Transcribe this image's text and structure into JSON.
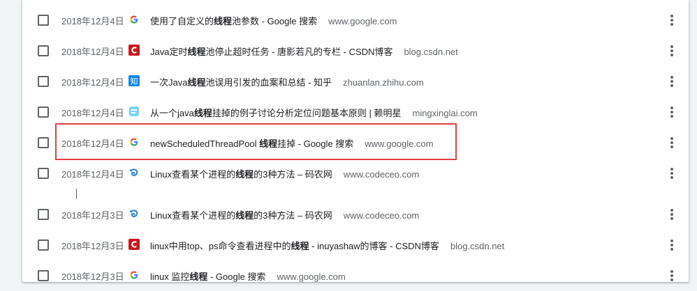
{
  "history": {
    "items": [
      {
        "date": "2018年12月4日",
        "favicon": "google-icon",
        "pre": "使用了自定义的",
        "bold": "线程",
        "post": "池参数 - Google 搜索",
        "domain": "www.google.com"
      },
      {
        "date": "2018年12月4日",
        "favicon": "csdn-icon",
        "pre": "Java定时",
        "bold": "线程",
        "post": "池停止超时任务 - 唐影若凡的专栏 - CSDN博客",
        "domain": "blog.csdn.net"
      },
      {
        "date": "2018年12月4日",
        "favicon": "zhihu-icon",
        "pre": "一次Java",
        "bold": "线程",
        "post": "池误用引发的血案和总结 - 知乎",
        "domain": "zhuanlan.zhihu.com"
      },
      {
        "date": "2018年12月4日",
        "favicon": "blog-icon",
        "pre": "从一个java",
        "bold": "线程",
        "post": "挂掉的例子讨论分析定位问题基本原则 | 赖明星",
        "domain": "mingxinglai.com"
      },
      {
        "date": "2018年12月4日",
        "favicon": "google-icon",
        "pre": "newScheduledThreadPool ",
        "bold": "线程",
        "post": "挂掉 - Google 搜索",
        "domain": "www.google.com"
      },
      {
        "date": "2018年12月4日",
        "favicon": "codeceo-icon",
        "pre": "Linux查看某个进程的",
        "bold": "线程",
        "post": "的3种方法 – 码农网",
        "domain": "www.codeceo.com"
      },
      {
        "date": "2018年12月3日",
        "favicon": "codeceo-icon",
        "pre": "Linux查看某个进程的",
        "bold": "线程",
        "post": "的3种方法 – 码农网",
        "domain": "www.codeceo.com"
      },
      {
        "date": "2018年12月3日",
        "favicon": "csdn-icon",
        "pre": "linux中用top、ps命令查看进程中的",
        "bold": "线程",
        "post": " - inuyashaw的博客 - CSDN博客",
        "domain": "blog.csdn.net"
      },
      {
        "date": "2018年12月3日",
        "favicon": "google-icon",
        "pre": "linux 监控",
        "bold": "线程",
        "post": " - Google 搜索",
        "domain": "www.google.com"
      }
    ]
  },
  "colors": {
    "highlight_border": "#e0403a",
    "csdn_red": "#c9171e",
    "zhihu_blue": "#0f88eb",
    "codeceo_blue": "#2a7fd1"
  }
}
